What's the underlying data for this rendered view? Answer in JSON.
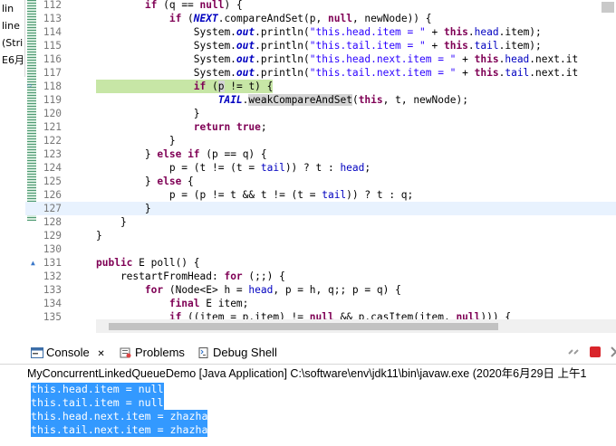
{
  "left_strip": [
    "lin",
    "line",
    "(Stri",
    "E6月"
  ],
  "editor": {
    "lines": [
      {
        "n": "112",
        "segs": [
          [
            "",
            "        "
          ],
          [
            "kw",
            "if"
          ],
          [
            "",
            " (q == "
          ],
          [
            "kw",
            "null"
          ],
          [
            "",
            ") {"
          ]
        ]
      },
      {
        "n": "113",
        "segs": [
          [
            "",
            "            "
          ],
          [
            "kw",
            "if"
          ],
          [
            "",
            " ("
          ],
          [
            "sfld",
            "NEXT"
          ],
          [
            "",
            ".compareAndSet(p, "
          ],
          [
            "kw",
            "null"
          ],
          [
            "",
            ", newNode)) {"
          ]
        ]
      },
      {
        "n": "114",
        "segs": [
          [
            "",
            "                System."
          ],
          [
            "sfld",
            "out"
          ],
          [
            "",
            ".println("
          ],
          [
            "str",
            "\"this.head.item = \""
          ],
          [
            "",
            " + "
          ],
          [
            "kw",
            "this"
          ],
          [
            "",
            "."
          ],
          [
            "fld",
            "head"
          ],
          [
            "",
            ".item);"
          ]
        ]
      },
      {
        "n": "115",
        "segs": [
          [
            "",
            "                System."
          ],
          [
            "sfld",
            "out"
          ],
          [
            "",
            ".println("
          ],
          [
            "str",
            "\"this.tail.item = \""
          ],
          [
            "",
            " + "
          ],
          [
            "kw",
            "this"
          ],
          [
            "",
            "."
          ],
          [
            "fld",
            "tail"
          ],
          [
            "",
            ".item);"
          ]
        ]
      },
      {
        "n": "116",
        "segs": [
          [
            "",
            "                System."
          ],
          [
            "sfld",
            "out"
          ],
          [
            "",
            ".println("
          ],
          [
            "str",
            "\"this.head.next.item = \""
          ],
          [
            "",
            " + "
          ],
          [
            "kw",
            "this"
          ],
          [
            "",
            "."
          ],
          [
            "fld",
            "head"
          ],
          [
            "",
            ".next.it"
          ]
        ]
      },
      {
        "n": "117",
        "segs": [
          [
            "",
            "                System."
          ],
          [
            "sfld",
            "out"
          ],
          [
            "",
            ".println("
          ],
          [
            "str",
            "\"this.tail.next.item = \""
          ],
          [
            "",
            " + "
          ],
          [
            "kw",
            "this"
          ],
          [
            "",
            "."
          ],
          [
            "fld",
            "tail"
          ],
          [
            "",
            ".next.it"
          ]
        ]
      },
      {
        "n": "118",
        "segs": [
          [
            "",
            "                "
          ],
          [
            "kw",
            "if"
          ],
          [
            "",
            " ("
          ],
          [
            "occ",
            "p"
          ],
          [
            "",
            " != t) {"
          ]
        ]
      },
      {
        "n": "119",
        "segs": [
          [
            "",
            "                    "
          ],
          [
            "sfld",
            "TAIL"
          ],
          [
            "",
            "."
          ],
          [
            "occ",
            "weakCompareAndSet"
          ],
          [
            "",
            "("
          ],
          [
            "kw",
            "this"
          ],
          [
            "",
            ", t, newNode);"
          ]
        ]
      },
      {
        "n": "120",
        "segs": [
          [
            "",
            "                }"
          ]
        ]
      },
      {
        "n": "121",
        "segs": [
          [
            "",
            "                "
          ],
          [
            "kw",
            "return"
          ],
          [
            "",
            " "
          ],
          [
            "kw",
            "true"
          ],
          [
            "",
            ";"
          ]
        ]
      },
      {
        "n": "122",
        "segs": [
          [
            "",
            "            }"
          ]
        ]
      },
      {
        "n": "123",
        "segs": [
          [
            "",
            "        } "
          ],
          [
            "kw",
            "else"
          ],
          [
            "",
            " "
          ],
          [
            "kw",
            "if"
          ],
          [
            "",
            " (p == q) {"
          ]
        ]
      },
      {
        "n": "124",
        "segs": [
          [
            "",
            "            p = (t != (t = "
          ],
          [
            "fld",
            "tail"
          ],
          [
            "",
            ")) ? t : "
          ],
          [
            "fld",
            "head"
          ],
          [
            "",
            ";"
          ]
        ]
      },
      {
        "n": "125",
        "segs": [
          [
            "",
            "        } "
          ],
          [
            "kw",
            "else"
          ],
          [
            "",
            " {"
          ]
        ]
      },
      {
        "n": "126",
        "segs": [
          [
            "",
            "            p = (p != t && t != (t = "
          ],
          [
            "fld",
            "tail"
          ],
          [
            "",
            ")) ? t : q;"
          ]
        ]
      },
      {
        "n": "127",
        "segs": [
          [
            "",
            "        }"
          ]
        ]
      },
      {
        "n": "128",
        "segs": [
          [
            "",
            "    }"
          ]
        ]
      },
      {
        "n": "129",
        "segs": [
          [
            "",
            "}"
          ]
        ]
      },
      {
        "n": "130",
        "segs": [
          [
            "",
            ""
          ]
        ]
      },
      {
        "n": "131",
        "segs": [
          [
            "kw",
            "public"
          ],
          [
            "",
            " E poll() {"
          ]
        ]
      },
      {
        "n": "132",
        "segs": [
          [
            "",
            "    restartFromHead: "
          ],
          [
            "kw",
            "for"
          ],
          [
            "",
            " (;;) {"
          ]
        ]
      },
      {
        "n": "133",
        "segs": [
          [
            "",
            "        "
          ],
          [
            "kw",
            "for"
          ],
          [
            "",
            " (Node<E> h = "
          ],
          [
            "fld",
            "head"
          ],
          [
            "",
            ", p = h, q;; p = q) {"
          ]
        ]
      },
      {
        "n": "134",
        "segs": [
          [
            "",
            "            "
          ],
          [
            "kw",
            "final"
          ],
          [
            "",
            " E item;"
          ]
        ]
      },
      {
        "n": "135",
        "segs": [
          [
            "",
            "            "
          ],
          [
            "kw",
            "if"
          ],
          [
            "",
            " ((item = p.item) != "
          ],
          [
            "kw",
            "null"
          ],
          [
            "",
            " && p.casItem(item, "
          ],
          [
            "kw",
            "null"
          ],
          [
            "",
            "))) {"
          ]
        ]
      }
    ]
  },
  "panel": {
    "tabs": {
      "console": "Console",
      "problems": "Problems",
      "debug_shell": "Debug Shell"
    },
    "console_title": "MyConcurrentLinkedQueueDemo [Java Application] C:\\software\\env\\jdk11\\bin\\javaw.exe  (2020年6月29日 上午1",
    "output": [
      "this.head.item = null",
      "this.tail.item = null",
      "this.head.next.item = zhazha",
      "this.tail.next.item = zhazha"
    ]
  },
  "colors": {
    "keyword": "#7f0055",
    "string": "#2a00ff",
    "field": "#0000c0",
    "selection": "#3399ff",
    "debug_line": "#c7e6a6"
  }
}
